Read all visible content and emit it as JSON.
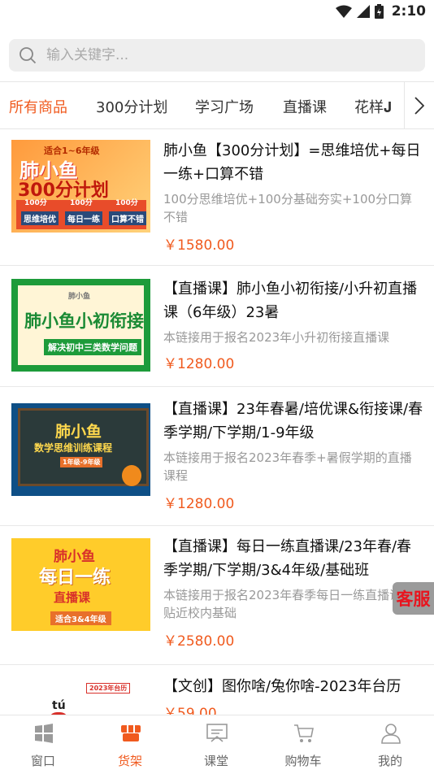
{
  "status": {
    "time": "2:10"
  },
  "search": {
    "placeholder": "输入关键字..."
  },
  "tabs": [
    "所有商品",
    "300分计划",
    "学习广场",
    "直播课",
    "花样𝐉"
  ],
  "products": [
    {
      "title": "肺小鱼【300分计划】=思维培优+每日一练+口算不错",
      "desc": "100分思维培优+100分基础夯实+100分口算不错",
      "price": "￥1580.00",
      "thumb": {
        "badge": "适合1~6年级",
        "line1": "肺小鱼",
        "line2": "300分计划",
        "tags": [
          "100分",
          "100分",
          "100分"
        ],
        "sub1": "思维培优",
        "sub2": "每日一练",
        "sub3": "口算不错"
      }
    },
    {
      "title": "【直播课】肺小鱼小初衔接/小升初直播课（6年级）23暑",
      "desc": "本链接用于报名2023年小升初衔接直播课",
      "price": "￥1280.00",
      "thumb": {
        "brand": "肺小鱼",
        "main": "肺小鱼小初衔接",
        "tag": "解决初中三类数学问题"
      }
    },
    {
      "title": "【直播课】23年春暑/培优课&衔接课/春季学期/下学期/1-9年级",
      "desc": "本链接用于报名2023年春季+暑假学期的直播课程",
      "price": "￥1280.00",
      "thumb": {
        "line1": "肺小鱼",
        "line2": "数学思维训练课程",
        "tag": "1年级-9年级"
      }
    },
    {
      "title": "【直播课】每日一练直播课/23年春/春季学期/下学期/3&4年级/基础班",
      "desc": "本链接用于报名2023年春季每日一练直播课，贴近校内基础",
      "price": "￥2580.00",
      "thumb": {
        "line1": "肺小鱼",
        "line2": "每日一练",
        "line3": "直播课",
        "tag": "适合3&4年级"
      }
    },
    {
      "title": "【文创】图你啥/兔你啥-2023年台历",
      "desc": "",
      "price": "￥59.00",
      "thumb": {
        "banner": "2023年台历",
        "char": "tú"
      }
    }
  ],
  "service": "客服",
  "nav": [
    "窗口",
    "货架",
    "课堂",
    "购物车",
    "我的"
  ],
  "colors": {
    "accent": "#f05a1e",
    "price": "#f05a1e",
    "service_text": "#e8151f"
  }
}
